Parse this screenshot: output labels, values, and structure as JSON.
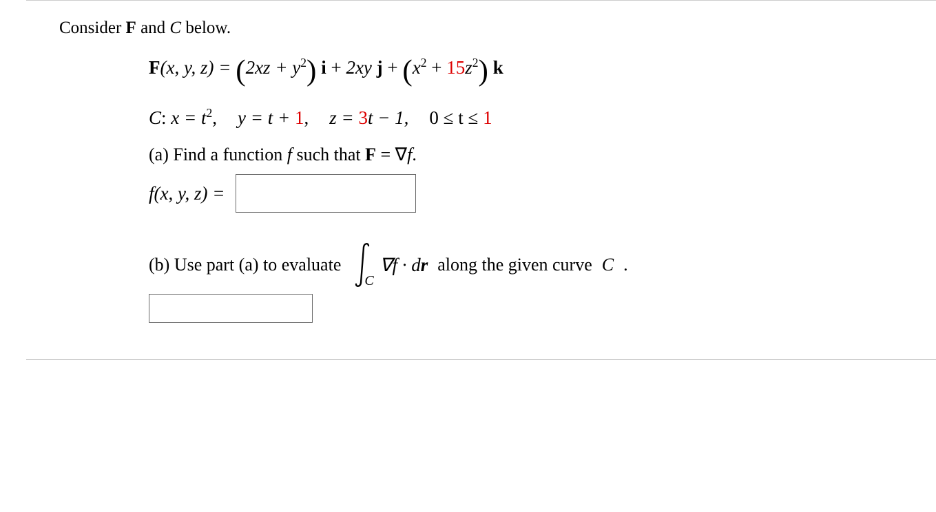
{
  "intro": {
    "prefix": "Consider ",
    "F": "F",
    "and": " and ",
    "C": "C",
    "suffix": " below."
  },
  "equation": {
    "lhs_F": "F",
    "lhs_args": "(x, y, z) = ",
    "term1_a": "2xz + y",
    "term1_exp": "2",
    "i": " i",
    "plus1": " + ",
    "term2": "2xy",
    "j": " j",
    "plus2": " + ",
    "term3_a": "x",
    "term3_exp1": "2",
    "term3_plus": " + ",
    "term3_red": "15",
    "term3_z": "z",
    "term3_exp2": "2",
    "k": " k"
  },
  "curve": {
    "C": "C",
    "colon": ": ",
    "x": "x = t",
    "x_exp": "2",
    "comma1": ",",
    "y": "y = t + ",
    "y_red": "1",
    "comma2": ",",
    "z_pre": "z = ",
    "z_red": "3",
    "z_post": "t − 1,",
    "range_pre": "0 ≤ t ≤ ",
    "range_red": "1"
  },
  "part_a": {
    "label": "(a) Find a function ",
    "f": "f",
    "mid": " such that ",
    "F": "F",
    "eq": " = ∇",
    "f2": "f",
    "dot": "."
  },
  "answer_a": {
    "lhs": "f(x, y, z) ="
  },
  "part_b": {
    "label": "(b) Use part (a) to evaluate",
    "integrand_pre": "∇",
    "integrand_f": "f ",
    "dot": "·",
    "dr": " d",
    "r": "r",
    "after": "  along the given curve ",
    "C": "C",
    "period": "."
  }
}
